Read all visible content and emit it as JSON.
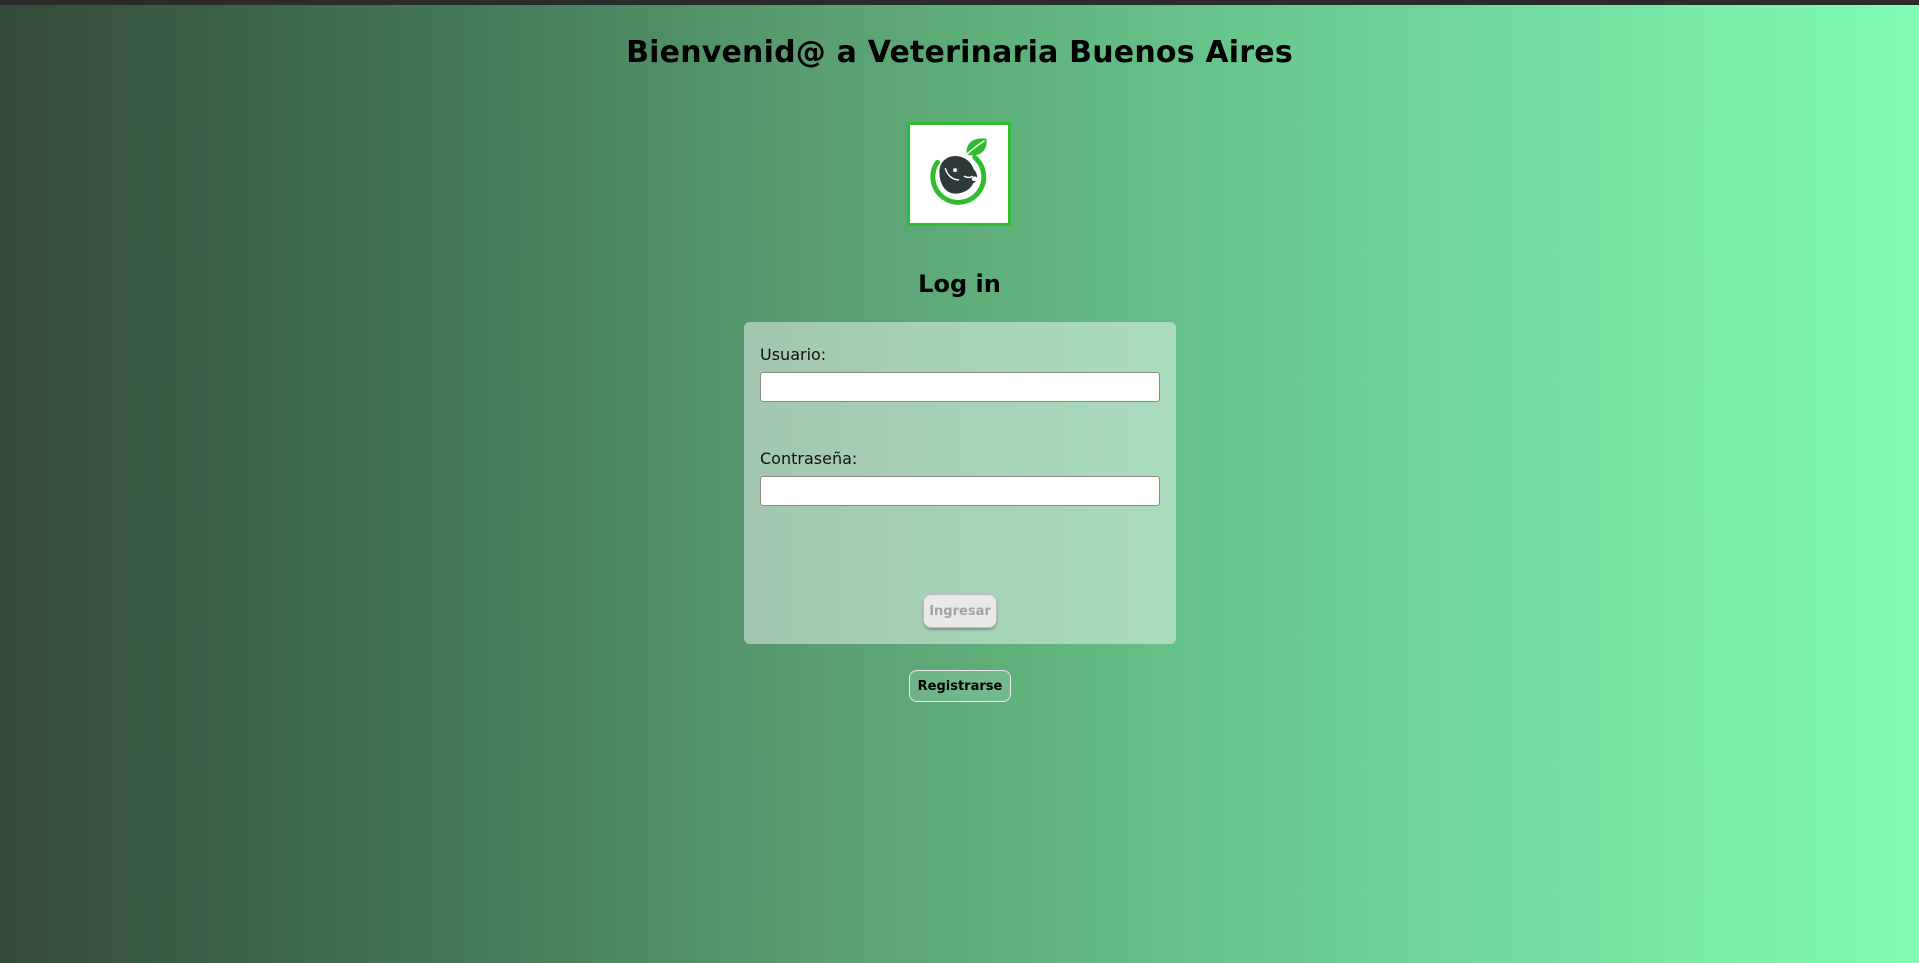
{
  "header": {
    "title": "Bienvenid@ a Veterinaria Buenos Aires"
  },
  "logo": {
    "icon": "veterinary-pet-leaf-logo",
    "accent_color": "#2fbd2f"
  },
  "login": {
    "title": "Log in",
    "username_label": "Usuario:",
    "username_value": "",
    "password_label": "Contraseña:",
    "password_value": "",
    "submit_label": "Ingresar"
  },
  "register": {
    "label": "Registrarse"
  },
  "colors": {
    "gradient_start": "#344b38",
    "gradient_end": "#80fcb4",
    "logo_border": "#2fbd2f"
  }
}
